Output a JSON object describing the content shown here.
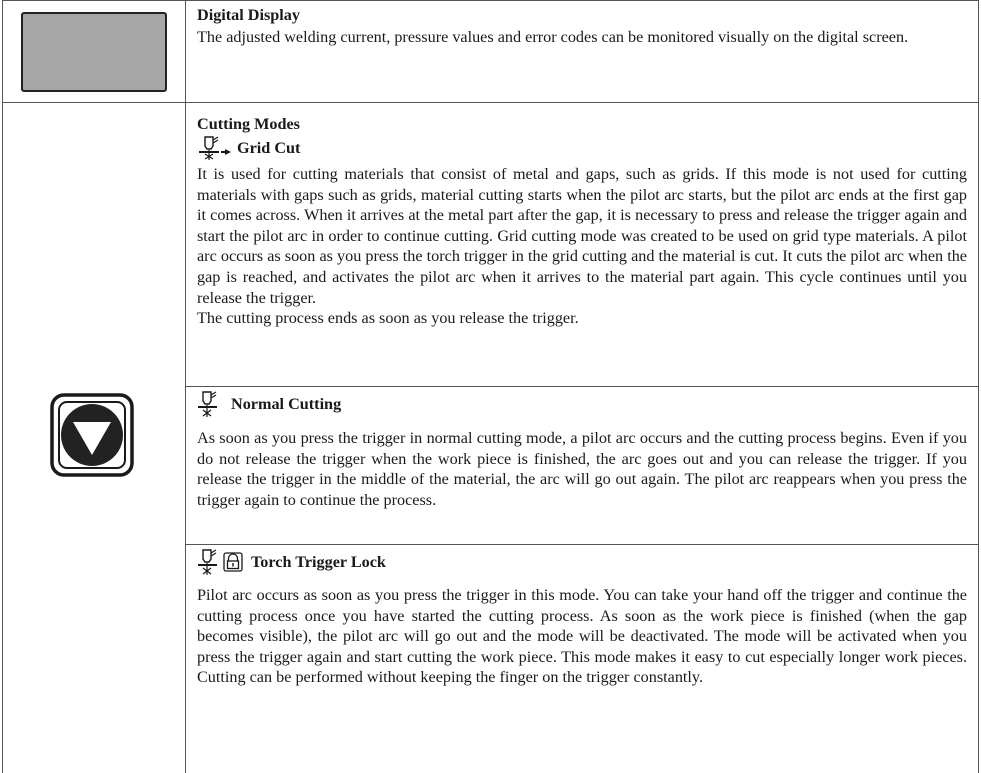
{
  "display_row": {
    "title": "Digital Display",
    "description": "The adjusted welding current, pressure values and error codes can be monitored visually on the digital screen."
  },
  "cutting_modes": {
    "title": "Cutting Modes",
    "grid_cut": {
      "icon": "torch-grid-cut-icon",
      "title": "Grid Cut",
      "paragraphs": [
        "It is used for cutting materials that consist of metal and gaps, such as grids. If this mode is not used for cutting materials with gaps such as grids, material cutting starts when the pilot arc starts, but the pilot arc ends at the first gap it comes across. When it arrives at the metal part after the gap, it is necessary to press and release the trigger again and start the pilot arc in order to continue cutting. Grid cutting mode was created to be used on grid type materials. A pilot arc occurs as soon as you press the torch trigger in the grid cutting and the material is cut. It cuts the pilot arc when the gap is reached, and activates the pilot arc when it arrives to the material part again. This cycle continues until you release the trigger.",
        "The cutting process ends as soon as you release the trigger."
      ]
    },
    "normal_cutting": {
      "icon": "torch-normal-cut-icon",
      "title": "Normal Cutting",
      "text": "As soon as you press the trigger in normal cutting mode, a pilot arc occurs and the cutting process begins. Even if you do not release the trigger when the work piece is finished, the arc goes out and you can release the trigger. If you release the trigger in the middle of the material, the arc will go out again. The pilot arc reappears when you press the trigger again to continue the process."
    },
    "torch_trigger_lock": {
      "icon": "torch-lock-icon",
      "title": "Torch Trigger Lock",
      "text": "Pilot arc occurs as soon as you press the trigger in this mode. You can take your hand off the trigger and continue the cutting process once you have started the cutting process. As soon as the work piece is finished (when the gap becomes visible), the pilot arc will go out and the mode will be deactivated. The mode will be activated when you press the trigger again and start cutting the work piece. This mode makes it easy to cut especially longer work pieces. Cutting can be performed without keeping the finger on the trigger constantly."
    }
  }
}
